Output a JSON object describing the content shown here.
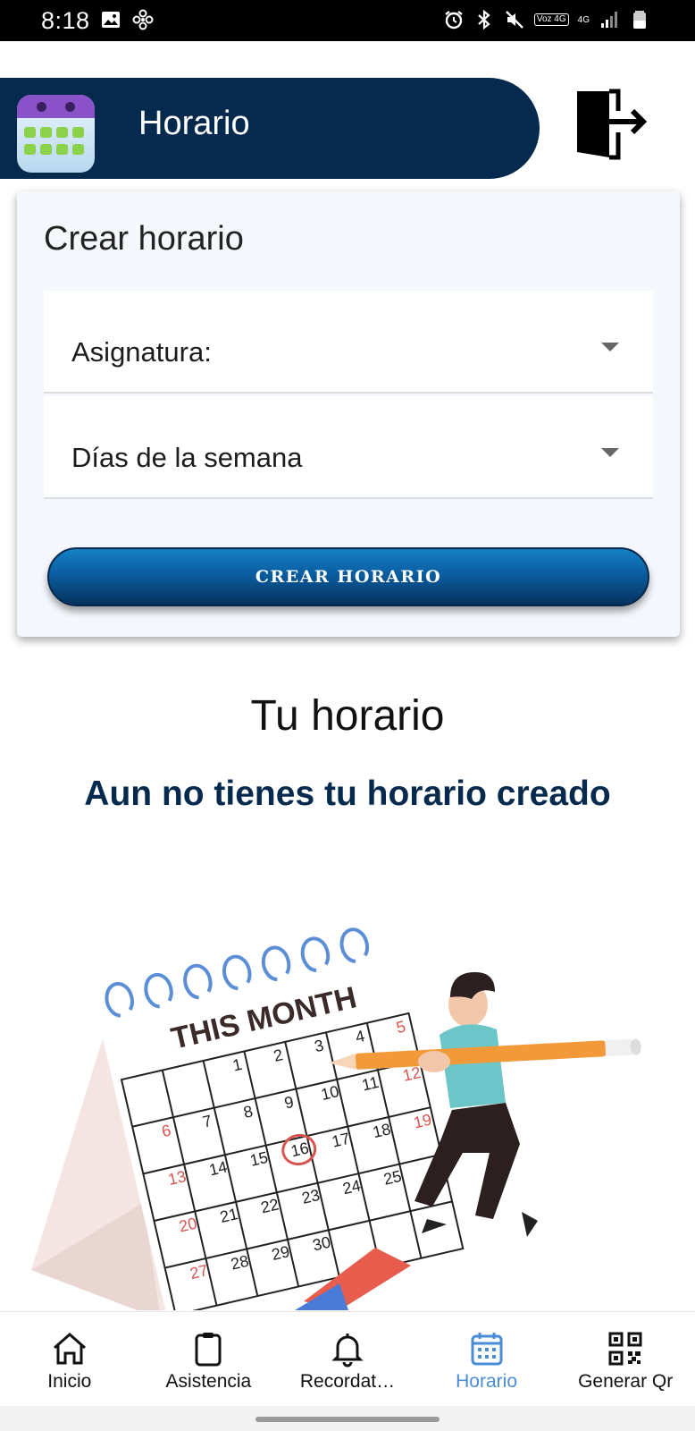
{
  "status_bar": {
    "time": "8:18",
    "volte": "Voz 4G",
    "network": "4G"
  },
  "header": {
    "title": "Horario",
    "brand_color": "#062a4d"
  },
  "create_card": {
    "title": "Crear horario",
    "fields": [
      {
        "label": "Asignatura:"
      },
      {
        "label": "Días de la semana"
      }
    ],
    "button_label": "CREAR HORARIO"
  },
  "schedule": {
    "title": "Tu horario",
    "empty_message": "Aun no tienes tu horario creado"
  },
  "illustration": {
    "heading": "THIS MONTH",
    "numbers": [
      "1",
      "2",
      "3",
      "4",
      "5",
      "6",
      "7",
      "8",
      "9",
      "10",
      "11",
      "12",
      "13",
      "14",
      "15",
      "16",
      "17",
      "18",
      "19",
      "20",
      "21",
      "22",
      "23",
      "24",
      "25",
      "27",
      "28",
      "29",
      "30"
    ]
  },
  "bottom_nav": {
    "items": [
      {
        "label": "Inicio",
        "icon": "home-icon"
      },
      {
        "label": "Asistencia",
        "icon": "clipboard-icon"
      },
      {
        "label": "Recordat…",
        "icon": "bell-icon"
      },
      {
        "label": "Horario",
        "icon": "calendar-icon",
        "active": true
      },
      {
        "label": "Generar Qr",
        "icon": "qr-code-icon"
      }
    ],
    "active_color": "#4a8cd6"
  }
}
